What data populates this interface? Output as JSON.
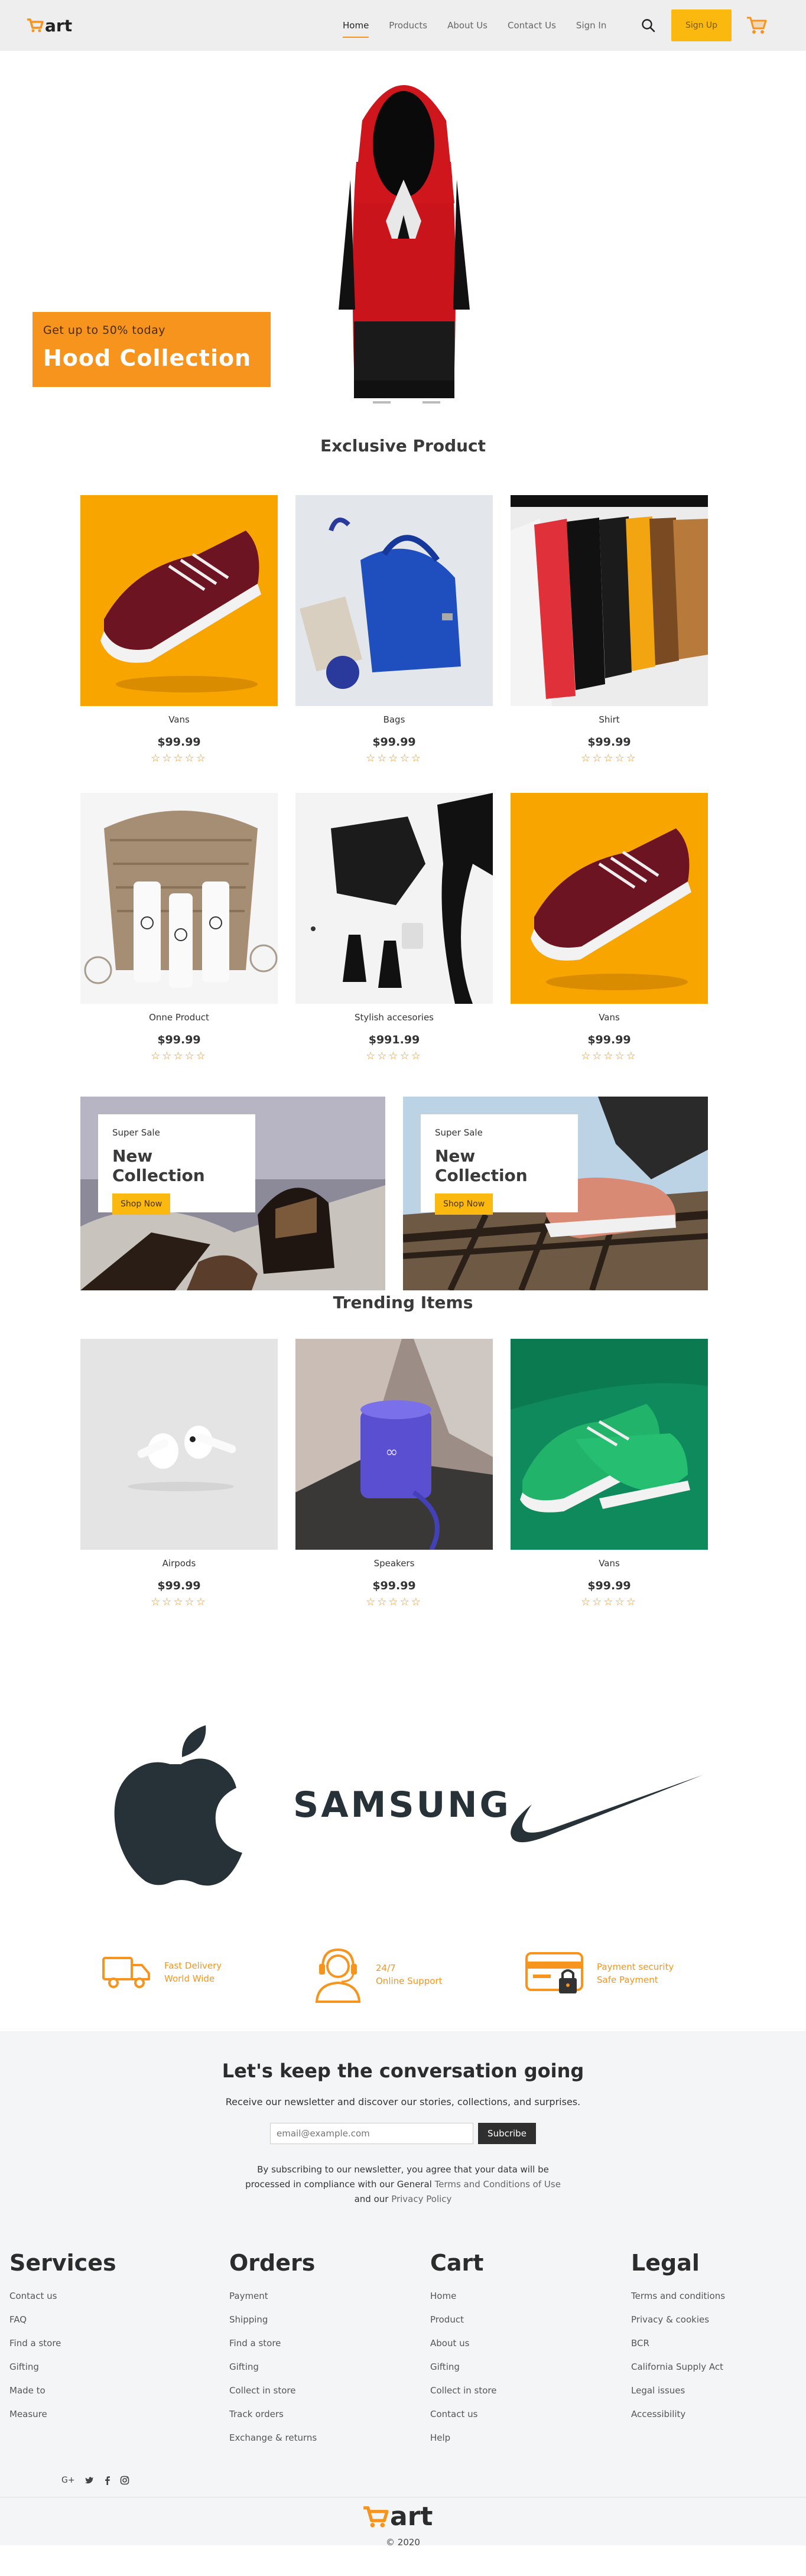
{
  "brand": {
    "logo_text": "art",
    "accent": "#f7941d",
    "yellow": "#fbb80f"
  },
  "nav": {
    "links": [
      "Home",
      "Products",
      "About Us",
      "Contact Us",
      "Sign In"
    ],
    "signup": "Sign Up",
    "search_icon": "search-icon",
    "cart_icon": "cart-icon"
  },
  "hero": {
    "subtitle": "Get up to 50% today",
    "title": "Hood Collection"
  },
  "exclusive": {
    "title": "Exclusive Product",
    "products": [
      {
        "name": "Vans",
        "price": "$99.99",
        "stars": "☆☆☆☆☆"
      },
      {
        "name": "Bags",
        "price": "$99.99",
        "stars": "☆☆☆☆☆"
      },
      {
        "name": "Shirt",
        "price": "$99.99",
        "stars": "☆☆☆☆☆"
      },
      {
        "name": "Onne Product",
        "price": "$99.99",
        "stars": "☆☆☆☆☆"
      },
      {
        "name": "Stylish accesories",
        "price": "$991.99",
        "stars": "☆☆☆☆☆"
      },
      {
        "name": "Vans",
        "price": "$99.99",
        "stars": "☆☆☆☆☆"
      }
    ]
  },
  "sale_banners": [
    {
      "subtitle": "Super Sale",
      "title": "New Collection",
      "button": "Shop Now"
    },
    {
      "subtitle": "Super Sale",
      "title": "New Collection",
      "button": "Shop Now"
    }
  ],
  "trending": {
    "title": "Trending Items",
    "products": [
      {
        "name": "Airpods",
        "price": "$99.99",
        "stars": "☆☆☆☆☆"
      },
      {
        "name": "Speakers",
        "price": "$99.99",
        "stars": "☆☆☆☆☆"
      },
      {
        "name": "Vans",
        "price": "$99.99",
        "stars": "☆☆☆☆☆"
      }
    ]
  },
  "brands": [
    "SAMSUNG"
  ],
  "features": [
    {
      "line1": "Fast Delivery",
      "line2": "World Wide",
      "icon": "truck-icon"
    },
    {
      "line1": "24/7",
      "line2": "Online Support",
      "icon": "support-agent-icon"
    },
    {
      "line1": "Payment security",
      "line2": "Safe Payment",
      "icon": "secure-card-icon"
    }
  ],
  "newsletter": {
    "title": "Let's keep the conversation going",
    "text": "Receive our newsletter and discover our stories, collections, and surprises.",
    "placeholder": "email@example.com",
    "button": "Subcribe",
    "legal_line1": "By subscribing to our newsletter, you agree that your data will be",
    "legal_line2_a": "processed in compliance with our General ",
    "legal_line2_link": "Terms and Conditions of Use",
    "legal_line3_a": "and our ",
    "legal_line3_link": "Privacy Policy"
  },
  "footer": {
    "columns": [
      {
        "title": "Services",
        "items": [
          "Contact us",
          "FAQ",
          "Find a store",
          "Gifting",
          "Made to",
          "Measure"
        ]
      },
      {
        "title": "Orders",
        "items": [
          "Payment",
          "Shipping",
          "Find a store",
          "Gifting",
          "Collect in store",
          "Track orders",
          "Exchange & returns"
        ]
      },
      {
        "title": "Cart",
        "items": [
          "Home",
          "Product",
          "About us",
          "Gifting",
          "Collect in store",
          "Contact us",
          "Help"
        ]
      },
      {
        "title": "Legal",
        "items": [
          "Terms and conditions",
          "Privacy & cookies",
          "BCR",
          "California Supply Act",
          "Legal issues",
          "Accessibility"
        ]
      }
    ],
    "social": [
      "G+",
      "twitter-icon",
      "facebook-icon",
      "instagram-icon"
    ],
    "logo_text": "art",
    "copyright": "© 2020"
  }
}
